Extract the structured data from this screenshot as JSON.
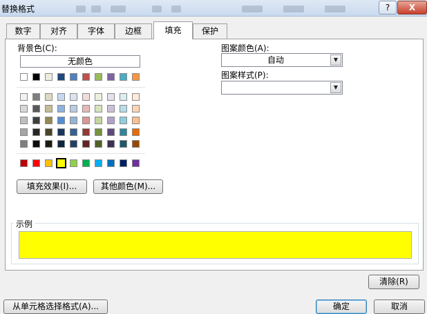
{
  "window": {
    "title": "替换格式",
    "help_label": "?",
    "close_label": "X"
  },
  "tabs": [
    {
      "label": "数字"
    },
    {
      "label": "对齐"
    },
    {
      "label": "字体"
    },
    {
      "label": "边框"
    },
    {
      "label": "填充"
    },
    {
      "label": "保护"
    }
  ],
  "active_tab": "填充",
  "fill": {
    "background_label": "背景色(C):",
    "no_color_label": "无颜色",
    "pattern_color_label": "图案颜色(A):",
    "pattern_color_value": "自动",
    "pattern_style_label": "图案样式(P):",
    "pattern_style_value": "",
    "fill_effects_button": "填充效果(I)...",
    "more_colors_button": "其他颜色(M)...",
    "sample_label": "示例",
    "sample_color": "#ffff00",
    "selected_color": "#ffff00",
    "clear_button": "清除(R)"
  },
  "palette": {
    "theme_top": [
      "#ffffff",
      "#000000",
      "#eeece1",
      "#1f497d",
      "#4f81bd",
      "#c0504d",
      "#9bbb59",
      "#8064a2",
      "#4bacc6",
      "#f79646"
    ],
    "shades": [
      [
        "#f2f2f2",
        "#7f7f7f",
        "#ddd9c3",
        "#c6d9f0",
        "#dbe5f1",
        "#f2dcdb",
        "#ebf1dd",
        "#e5e0ec",
        "#dbeef3",
        "#fdeada"
      ],
      [
        "#d8d8d8",
        "#595959",
        "#c4bd97",
        "#8db3e2",
        "#b8cce4",
        "#e5b9b7",
        "#d7e3bc",
        "#ccc1d9",
        "#b7dde8",
        "#fbd5b5"
      ],
      [
        "#bfbfbf",
        "#3f3f3f",
        "#938953",
        "#548dd4",
        "#95b3d7",
        "#d99694",
        "#c3d69b",
        "#b2a2c7",
        "#92cddc",
        "#fac08f"
      ],
      [
        "#a5a5a5",
        "#262626",
        "#494429",
        "#17365d",
        "#366092",
        "#953734",
        "#76923c",
        "#5f497a",
        "#31859b",
        "#e36c09"
      ],
      [
        "#7f7f7f",
        "#0c0c0c",
        "#1d1b10",
        "#0f243e",
        "#244061",
        "#632423",
        "#4f6128",
        "#3f3151",
        "#205867",
        "#974806"
      ]
    ],
    "standard": [
      "#c00000",
      "#ff0000",
      "#ffc000",
      "#ffff00",
      "#92d050",
      "#00b050",
      "#00b0f0",
      "#0070c0",
      "#002060",
      "#7030a0"
    ]
  },
  "footer": {
    "from_cell_button": "从单元格选择格式(A)...",
    "ok_button": "确定",
    "cancel_button": "取消"
  }
}
